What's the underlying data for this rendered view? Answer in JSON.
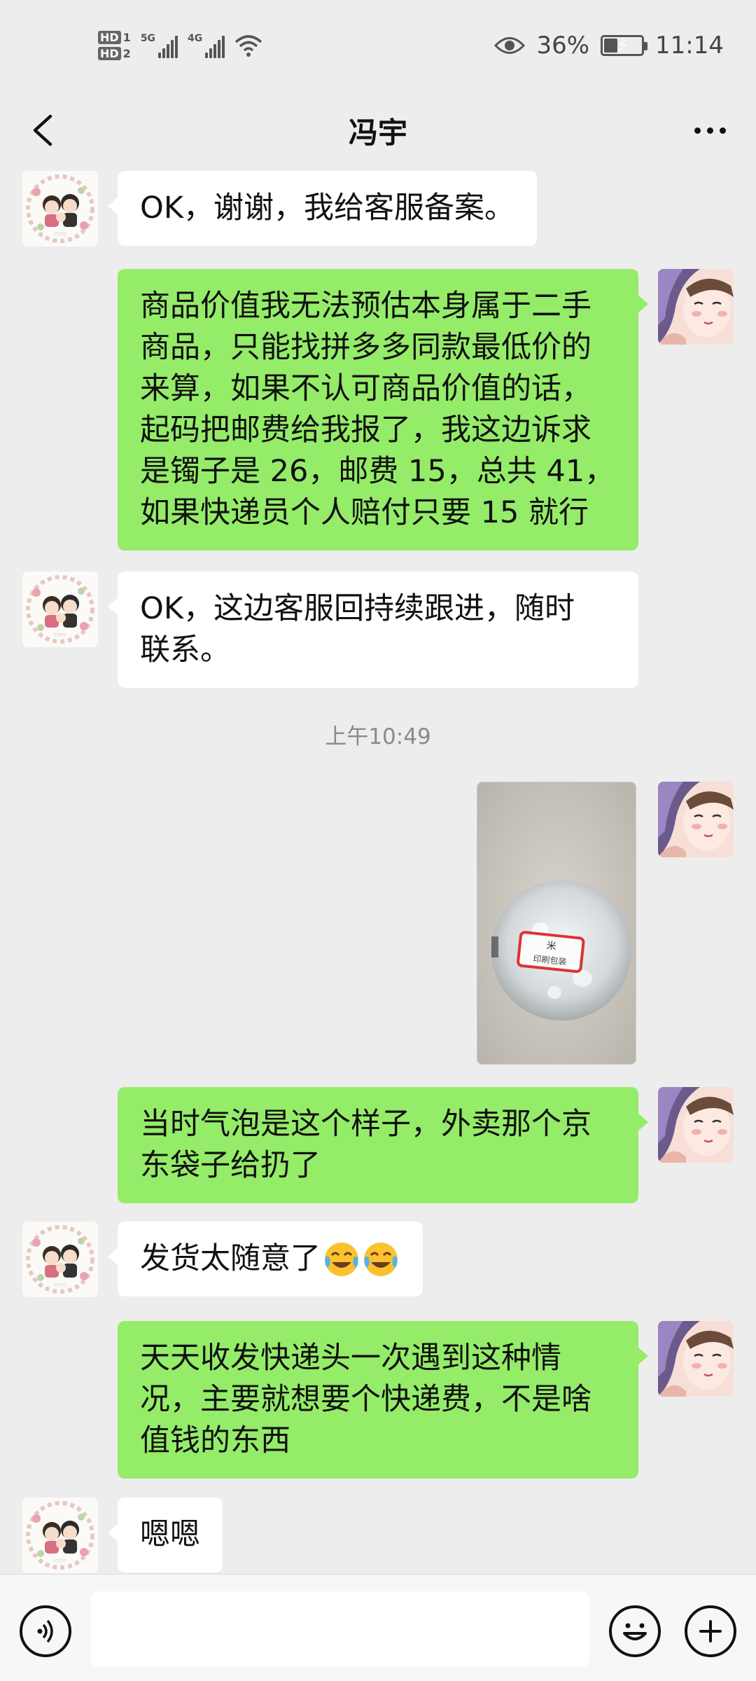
{
  "status_bar": {
    "sim1_badge": "HD",
    "sim1_num": "1",
    "sim2_badge": "HD",
    "sim2_num": "2",
    "net1": "5G",
    "net2": "4G",
    "battery_percent": "36%",
    "battery_level": 0.36,
    "time": "11:14",
    "icons": [
      "signal-icon",
      "wifi-icon",
      "eye-icon",
      "battery-icon"
    ]
  },
  "nav": {
    "title": "冯宇",
    "back_icon": "chevron-left-icon",
    "more_icon": "more-dots-icon"
  },
  "messages": [
    {
      "side": "in",
      "text": "OK，谢谢，我给客服备案。"
    },
    {
      "side": "out",
      "lines": [
        "商品价值我无法预估本身属于二手",
        "商品，只能找拼多多同款最低价的",
        "来算，如果不认可商品价值的话，",
        "起码把邮费给我报了，我这边诉求",
        "是镯子是 26，邮费 15，总共 41，",
        "如果快递员个人赔付只要 15 就行"
      ]
    },
    {
      "side": "in",
      "lines": [
        "OK，这边客服回持续跟进，随时",
        "联系。"
      ]
    },
    {
      "side": "out",
      "lines": [
        "当时气泡是这个样子，外卖那个京",
        "东袋子给扔了"
      ]
    },
    {
      "side": "in",
      "text": "发货太随意了"
    },
    {
      "side": "out",
      "lines": [
        "天天收发快递头一次遇到这种情",
        "况，主要就想要个快递费，不是啥",
        "值钱的东西"
      ]
    },
    {
      "side": "in",
      "text": "嗯嗯"
    }
  ],
  "timestamp": "上午10:49",
  "photo_label": [
    "米",
    "印刷包装"
  ],
  "input_bar": {
    "voice_icon": "voice-icon",
    "emoji_icon": "emoji-icon",
    "plus_icon": "plus-icon",
    "input_value": ""
  },
  "colors": {
    "background": "#ededed",
    "out_bubble": "#95ec69",
    "in_bubble": "#ffffff"
  }
}
